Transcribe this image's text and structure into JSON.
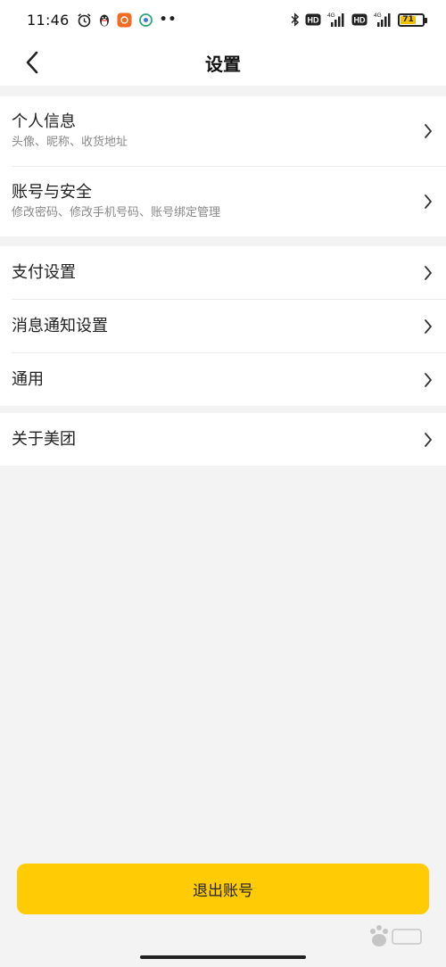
{
  "status_bar": {
    "time": "11:46",
    "battery_level": "71",
    "battery_fraction": 0.71,
    "network_1": "4G",
    "network_2": "4G",
    "hd_1": "HD",
    "hd_2": "HD",
    "more_dots": "••",
    "icons_left": [
      "alarm-icon",
      "qq-penguin-icon",
      "app-badge-icon",
      "sync-app-icon"
    ],
    "icons_right": [
      "bluetooth-icon",
      "hd-icon",
      "signal-icon",
      "hd-icon",
      "signal-icon",
      "battery-icon"
    ]
  },
  "nav": {
    "title": "设置",
    "back_icon": "chevron-left-icon"
  },
  "groups": [
    {
      "items": [
        {
          "title": "个人信息",
          "subtitle": "头像、昵称、收货地址"
        },
        {
          "title": "账号与安全",
          "subtitle": "修改密码、修改手机号码、账号绑定管理"
        }
      ]
    },
    {
      "items": [
        {
          "title": "支付设置"
        },
        {
          "title": "消息通知设置"
        },
        {
          "title": "通用"
        }
      ]
    },
    {
      "items": [
        {
          "title": "关于美团"
        }
      ]
    }
  ],
  "logout": {
    "label": "退出账号"
  },
  "colors": {
    "accent": "#ffcb05",
    "background": "#f3f3f3",
    "card": "#ffffff",
    "subtitle": "#888888"
  }
}
